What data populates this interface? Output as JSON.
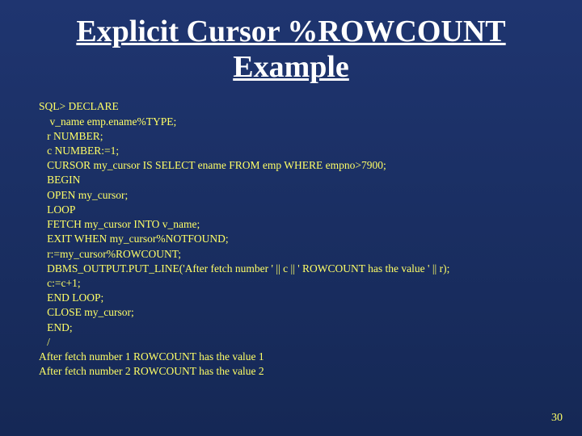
{
  "slide": {
    "title": "Explicit Cursor %ROWCOUNT Example",
    "code": "SQL> DECLARE\n    v_name emp.ename%TYPE;\n   r NUMBER;\n   c NUMBER:=1;\n   CURSOR my_cursor IS SELECT ename FROM emp WHERE empno>7900;\n   BEGIN\n   OPEN my_cursor;\n   LOOP\n   FETCH my_cursor INTO v_name;\n   EXIT WHEN my_cursor%NOTFOUND;\n   r:=my_cursor%ROWCOUNT;\n   DBMS_OUTPUT.PUT_LINE('After fetch number ' || c || ' ROWCOUNT has the value ' || r);\n   c:=c+1;\n   END LOOP;\n   CLOSE my_cursor;\n   END;\n   /\nAfter fetch number 1 ROWCOUNT has the value 1\nAfter fetch number 2 ROWCOUNT has the value 2",
    "page_number": "30"
  }
}
